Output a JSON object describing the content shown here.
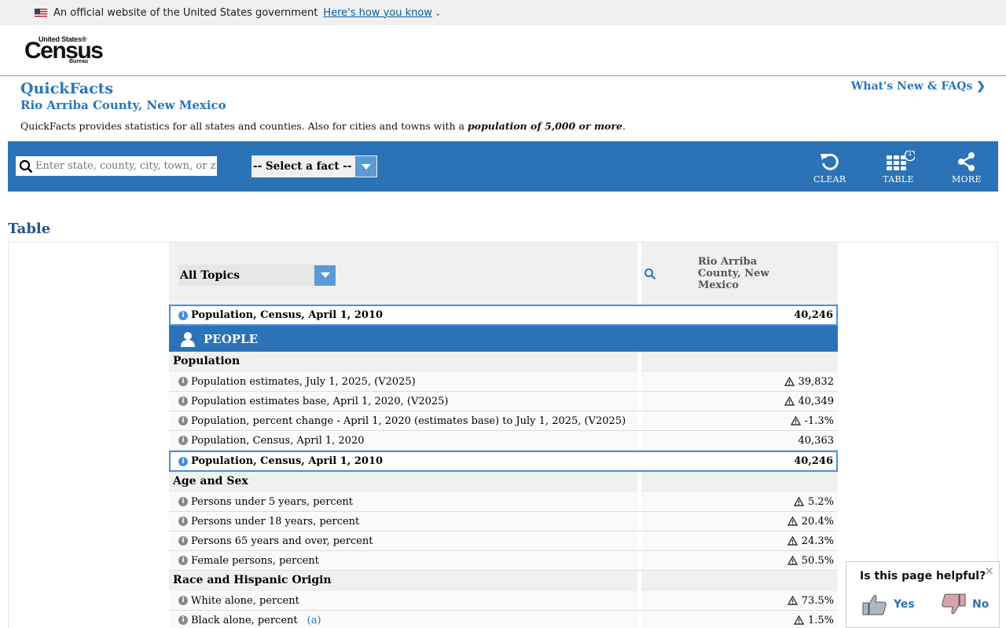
{
  "gov_banner": {
    "text": "An official website of the United States government",
    "link": "Here's how you know"
  },
  "logo": {
    "top": "United States®",
    "main": "Census",
    "bottom": "Bureau"
  },
  "quickfacts": {
    "title": "QuickFacts",
    "geography": "Rio Arriba County, New Mexico",
    "description_prefix": "QuickFacts provides statistics for all states and counties. Also for cities and towns with a ",
    "description_emphasis": "population of 5,000 or more",
    "description_suffix": ".",
    "whats_new": "What's New & FAQs"
  },
  "toolbar": {
    "search_placeholder": "Enter state, county, city, town, or zip code",
    "fact_select": "-- Select a fact --",
    "clear": "CLEAR",
    "table": "TABLE",
    "table_badge": "1",
    "more": "MORE",
    "brand_color": "#2b72b6"
  },
  "section_title": "Table",
  "table": {
    "topic_select": "All Topics",
    "column_geo": "Rio Arriba County, New Mexico",
    "selected_fact": {
      "label": "Population, Census, April 1, 2010",
      "value": "40,246"
    },
    "people_header": "PEOPLE",
    "categories": {
      "population": "Population",
      "age_sex": "Age and Sex",
      "race": "Race and Hispanic Origin"
    },
    "population_rows": [
      {
        "label": "Population estimates, July 1, 2025, (V2025)",
        "value": "39,832",
        "warn": true
      },
      {
        "label": "Population estimates base, April 1, 2020, (V2025)",
        "value": "40,349",
        "warn": true
      },
      {
        "label": "Population, percent change - April 1, 2020 (estimates base) to July 1, 2025, (V2025)",
        "value": "-1.3%",
        "warn": true
      },
      {
        "label": "Population, Census, April 1, 2020",
        "value": "40,363",
        "warn": false
      },
      {
        "label": "Population, Census, April 1, 2010",
        "value": "40,246",
        "warn": false
      }
    ],
    "age_sex_rows": [
      {
        "label": "Persons under 5 years, percent",
        "value": "5.2%"
      },
      {
        "label": "Persons under 18 years, percent",
        "value": "20.4%"
      },
      {
        "label": "Persons 65 years and over, percent",
        "value": "24.3%"
      },
      {
        "label": "Female persons, percent",
        "value": "50.5%"
      }
    ],
    "race_rows": [
      {
        "label": "White alone, percent",
        "value": "73.5%",
        "footnote": ""
      },
      {
        "label": "Black alone, percent",
        "value": "1.5%",
        "footnote": "(a)"
      }
    ]
  },
  "feedback": {
    "question": "Is this page helpful?",
    "yes": "Yes",
    "no": "No",
    "close": "×"
  }
}
